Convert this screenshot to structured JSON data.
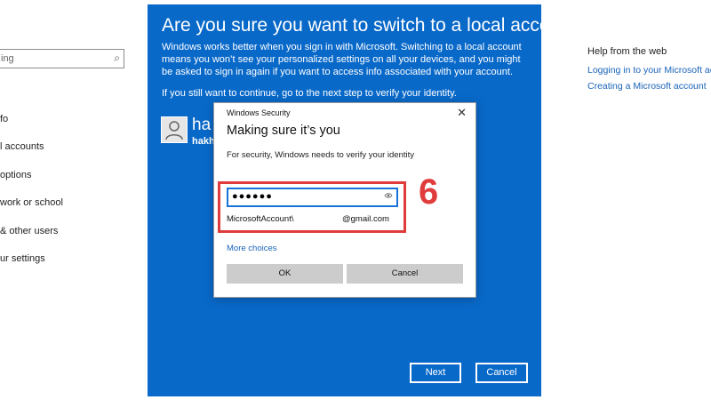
{
  "settings": {
    "search": {
      "placeholder": "ing"
    },
    "nav": [
      "fo",
      "l accounts",
      "options",
      "work or school",
      "& other users",
      "ur settings"
    ],
    "help": {
      "heading": "Help from the web",
      "links": [
        "Logging in to your Microsoft account",
        "Creating a Microsoft account"
      ]
    }
  },
  "wizard": {
    "title": "Are you sure you want to switch to a local account?",
    "description": "Windows works better when you sign in with Microsoft. Switching to a local account means you won’t see your personalized settings on all your devices, and you might be asked to sign in again if you want to access info associated with your account.",
    "continue_text": "If you still want to continue, go to the next step to verify your identity.",
    "user_name": "ha",
    "user_email": "hakhu",
    "next_label": "Next",
    "cancel_label": "Cancel"
  },
  "security_dialog": {
    "caption": "Windows Security",
    "close_glyph": "✕",
    "heading": "Making sure it’s you",
    "message": "For security, Windows needs to verify your identity",
    "password_value": "●●●●●●",
    "account_prefix": "MicrosoftAccount\\",
    "account_suffix": "@gmail.com",
    "more_choices": "More choices",
    "ok_label": "OK",
    "cancel_label": "Cancel"
  },
  "annotation": {
    "step_number": "6",
    "color": "#e03c3c"
  },
  "colors": {
    "wizard_blue": "#0969c9",
    "link_blue": "#1a63b8"
  }
}
